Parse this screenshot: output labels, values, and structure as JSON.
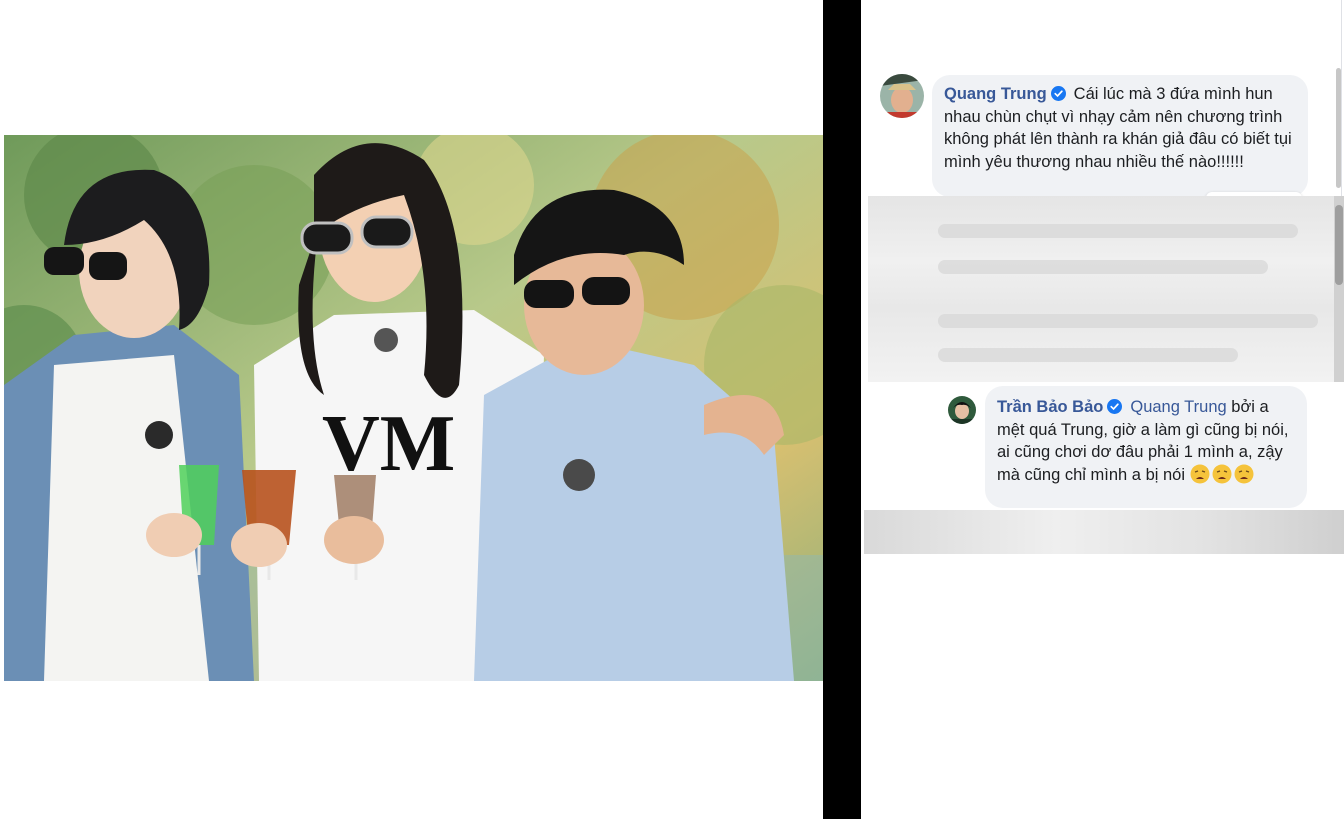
{
  "post": {
    "photo": {
      "description_icon": "group-photo-three-men",
      "shirt_print": "VM"
    }
  },
  "comments": [
    {
      "author": "Quang Trung",
      "verified": true,
      "text": "Cái lúc mà 3 đứa mình hun nhau chùn chụt vì nhạy cảm nên chương trình không phát lên thành ra khán giả đâu có biết tụi mình yêu thương nhau nhiều thế nào!!!!!!"
    },
    {
      "author": "Trần Bảo Bảo",
      "verified": true,
      "mention": "Quang Trung",
      "text": "bởi a mệt quá Trung, giờ a làm gì cũng bị nói, ai cũng chơi dơ đâu phải 1 mình a, zậy mà cũng chỉ mình a bị nói",
      "emoji_count": 3,
      "emoji_icon": "weary-face-icon"
    }
  ],
  "colors": {
    "author": "#385898",
    "bubble": "#f0f2f5",
    "verified": "#1877f2",
    "divider": "#000000"
  }
}
